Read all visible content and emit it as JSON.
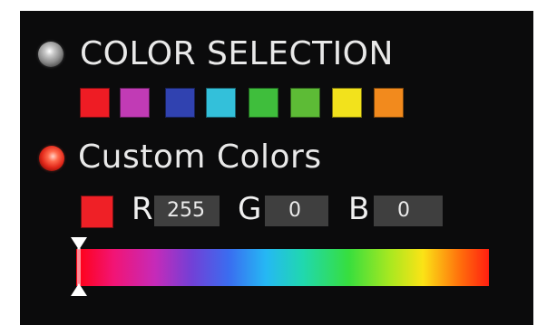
{
  "color_selection": {
    "label": "COLOR SELECTION",
    "radio_selected": false,
    "swatches": [
      {
        "name": "red",
        "color": "#ee1c24"
      },
      {
        "name": "magenta",
        "color": "#c13bb5"
      },
      {
        "name": "blue",
        "color": "#3042b0"
      },
      {
        "name": "cyan",
        "color": "#33c0da"
      },
      {
        "name": "green",
        "color": "#3fbe3c"
      },
      {
        "name": "light-green",
        "color": "#5dbb36"
      },
      {
        "name": "yellow",
        "color": "#f2e21c"
      },
      {
        "name": "orange",
        "color": "#f28a1d"
      }
    ]
  },
  "custom_colors": {
    "label": "Custom Colors",
    "radio_selected": true,
    "current_color": "#ef2026",
    "r_label": "R",
    "r_value": "255",
    "g_label": "G",
    "g_value": "0",
    "b_label": "B",
    "b_value": "0",
    "hue_position": 0
  }
}
